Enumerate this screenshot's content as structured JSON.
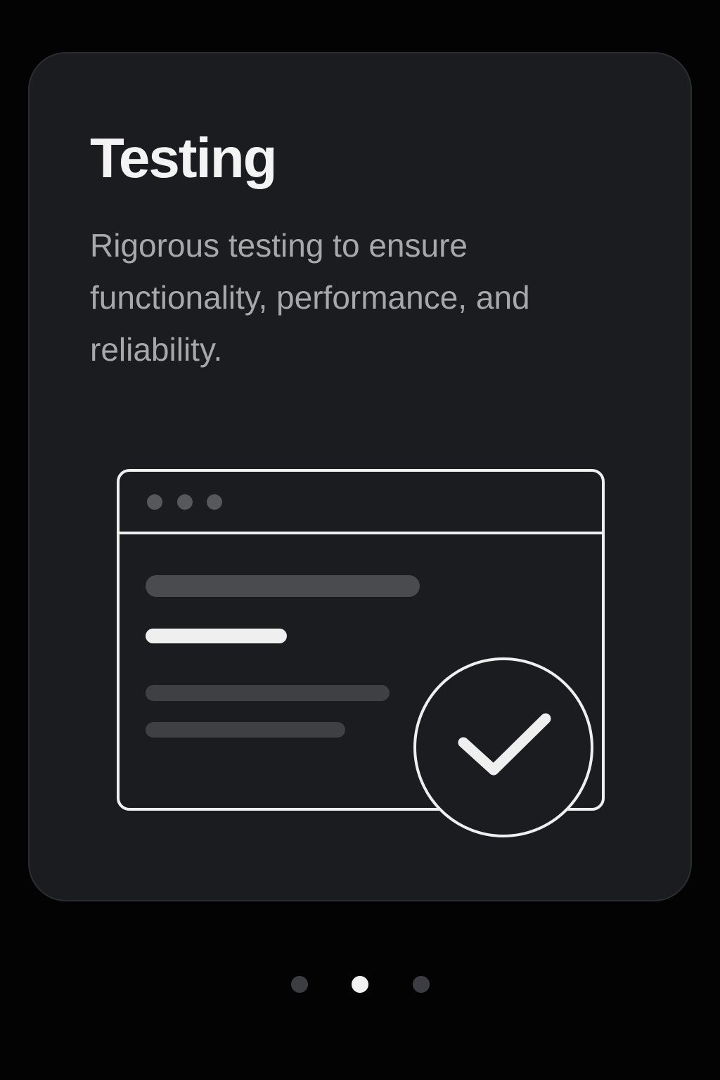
{
  "card": {
    "title": "Testing",
    "description": "Rigorous testing to ensure functionality, performance, and reliability."
  },
  "illustration": {
    "window_icon": "browser-window-icon",
    "check_icon": "checkmark-circle-icon",
    "colors": {
      "outline": "#efefef",
      "traffic_dot": "#57585c",
      "content_bar": "#4a4b4f",
      "highlight_bar": "#efefef"
    }
  },
  "pagination": {
    "total_pages": 3,
    "current_page": 2
  },
  "colors": {
    "background": "#030303",
    "card": "#1b1c20",
    "title": "#f3f3f3",
    "description": "#a7a8ab",
    "dot_active": "#f2f2f2",
    "dot_inactive": "#3c3d42"
  }
}
